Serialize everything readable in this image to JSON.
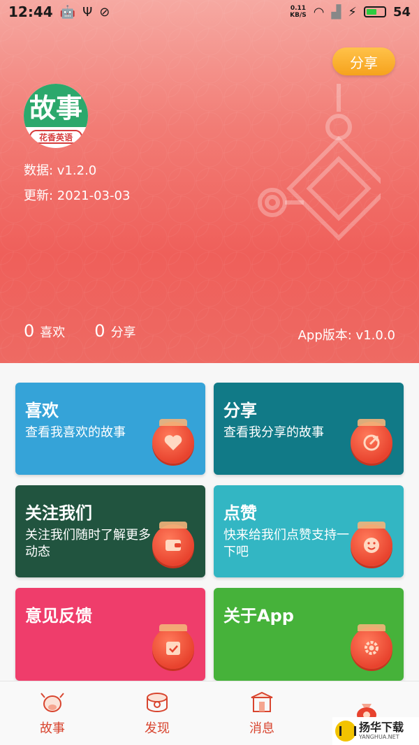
{
  "status_bar": {
    "time": "12:44",
    "net_speed_value": "0.11",
    "net_speed_unit": "KB/S",
    "battery_level": "54"
  },
  "header": {
    "share_button": "分享",
    "logo_main": "故事",
    "logo_sub": "花香英语",
    "data_version": "数据: v1.2.0",
    "update_date": "更新: 2021-03-03",
    "likes_count": "0",
    "likes_label": "喜欢",
    "shares_count": "0",
    "shares_label": "分享",
    "app_version": "App版本: v1.0.0"
  },
  "cards": [
    {
      "title": "喜欢",
      "desc": "查看我喜欢的故事",
      "icon": "heart-icon",
      "color": "#35a3d8"
    },
    {
      "title": "分享",
      "desc": "查看我分享的故事",
      "icon": "share-arrow-icon",
      "color": "#117a87"
    },
    {
      "title": "关注我们",
      "desc": "关注我们随时了解更多动态",
      "icon": "wallet-icon",
      "color": "#21543f"
    },
    {
      "title": "点赞",
      "desc": "快来给我们点赞支持一下吧",
      "icon": "smile-icon",
      "color": "#33b6c3"
    },
    {
      "title": "意见反馈",
      "desc": "",
      "icon": "calendar-check-icon",
      "color": "#ef3d6b"
    },
    {
      "title": "关于App",
      "desc": "",
      "icon": "gear-icon",
      "color": "#46b23a"
    }
  ],
  "tabbar": {
    "items": [
      {
        "label": "故事",
        "icon": "cow-icon"
      },
      {
        "label": "发现",
        "icon": "drum-icon"
      },
      {
        "label": "消息",
        "icon": "gate-icon"
      },
      {
        "label": "",
        "icon": "lucky-bag-icon"
      }
    ]
  },
  "watermark": {
    "cn": "扬华下载",
    "en": "YANGHUA.NET"
  },
  "colors": {
    "accent": "#d8452f",
    "share_pill": "#f6a21c"
  }
}
